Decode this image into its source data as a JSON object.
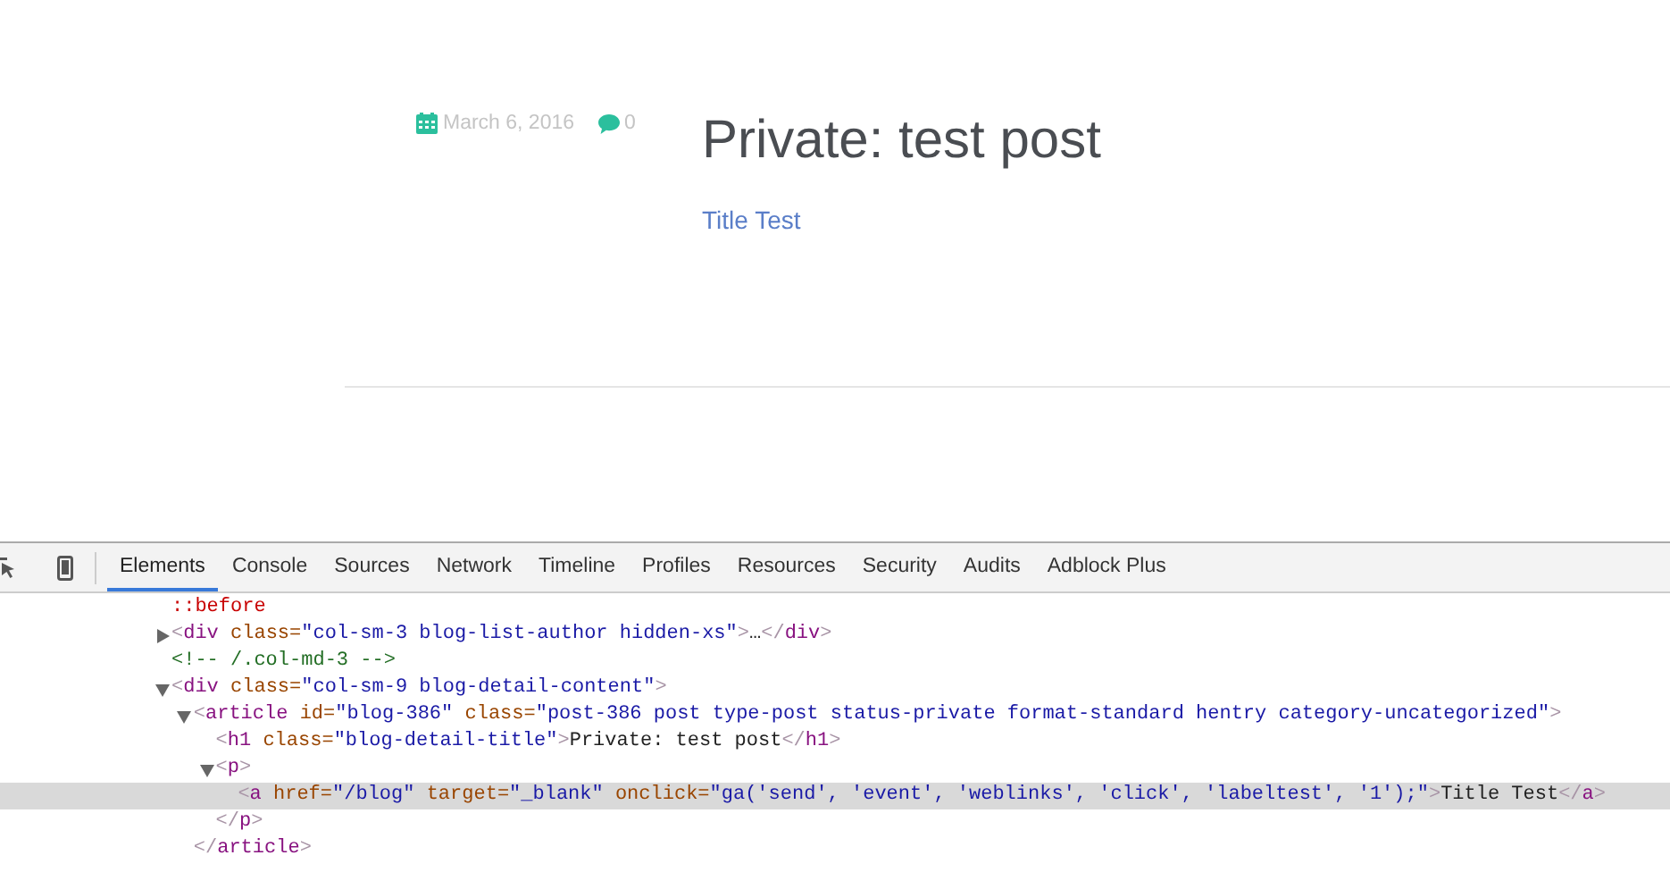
{
  "post": {
    "date": "March 6, 2016",
    "comments": "0",
    "title": "Private: test post",
    "link": "Title Test"
  },
  "devtools": {
    "tabs": [
      {
        "label": "Elements",
        "selected": true
      },
      {
        "label": "Console",
        "selected": false
      },
      {
        "label": "Sources",
        "selected": false
      },
      {
        "label": "Network",
        "selected": false
      },
      {
        "label": "Timeline",
        "selected": false
      },
      {
        "label": "Profiles",
        "selected": false
      },
      {
        "label": "Resources",
        "selected": false
      },
      {
        "label": "Security",
        "selected": false
      },
      {
        "label": "Audits",
        "selected": false
      },
      {
        "label": "Adblock Plus",
        "selected": false
      }
    ],
    "nodes": [
      {
        "selected": false,
        "tokens": [
          {
            "kind": "pseudo",
            "t": "::before"
          }
        ]
      },
      {
        "selected": false,
        "expanded": false,
        "tokens": [
          {
            "kind": "punct",
            "t": "<"
          },
          {
            "kind": "tag",
            "t": "div"
          },
          {
            "kind": "attr",
            "t": " class="
          },
          {
            "kind": "value",
            "t": "\"col-sm-3 blog-list-author hidden-xs\""
          },
          {
            "kind": "punct",
            "t": ">"
          },
          {
            "kind": "text",
            "t": "…"
          },
          {
            "kind": "punct",
            "t": "</"
          },
          {
            "kind": "tag",
            "t": "div"
          },
          {
            "kind": "punct",
            "t": ">"
          }
        ]
      },
      {
        "selected": false,
        "tokens": [
          {
            "kind": "comment",
            "t": "<!-- /.col-md-3 -->"
          }
        ]
      },
      {
        "selected": false,
        "expanded": true,
        "tokens": [
          {
            "kind": "punct",
            "t": "<"
          },
          {
            "kind": "tag",
            "t": "div"
          },
          {
            "kind": "attr",
            "t": " class="
          },
          {
            "kind": "value",
            "t": "\"col-sm-9 blog-detail-content\""
          },
          {
            "kind": "punct",
            "t": ">"
          }
        ],
        "children": [
          {
            "selected": false,
            "expanded": true,
            "tokens": [
              {
                "kind": "punct",
                "t": "<"
              },
              {
                "kind": "tag",
                "t": "article"
              },
              {
                "kind": "attr",
                "t": " id="
              },
              {
                "kind": "value",
                "t": "\"blog-386\""
              },
              {
                "kind": "attr",
                "t": " class="
              },
              {
                "kind": "value",
                "t": "\"post-386 post type-post status-private format-standard hentry category-uncategorized\""
              },
              {
                "kind": "punct",
                "t": ">"
              }
            ],
            "closing": [
              {
                "kind": "punct",
                "t": "</"
              },
              {
                "kind": "tag",
                "t": "article"
              },
              {
                "kind": "punct",
                "t": ">"
              }
            ],
            "children": [
              {
                "selected": false,
                "tokens": [
                  {
                    "kind": "punct",
                    "t": "<"
                  },
                  {
                    "kind": "tag",
                    "t": "h1"
                  },
                  {
                    "kind": "attr",
                    "t": " class="
                  },
                  {
                    "kind": "value",
                    "t": "\"blog-detail-title\""
                  },
                  {
                    "kind": "punct",
                    "t": ">"
                  },
                  {
                    "kind": "text",
                    "t": "Private: test post"
                  },
                  {
                    "kind": "punct",
                    "t": "</"
                  },
                  {
                    "kind": "tag",
                    "t": "h1"
                  },
                  {
                    "kind": "punct",
                    "t": ">"
                  }
                ]
              },
              {
                "selected": false,
                "expanded": true,
                "tokens": [
                  {
                    "kind": "punct",
                    "t": "<"
                  },
                  {
                    "kind": "tag",
                    "t": "p"
                  },
                  {
                    "kind": "punct",
                    "t": ">"
                  }
                ],
                "closing": [
                  {
                    "kind": "punct",
                    "t": "</"
                  },
                  {
                    "kind": "tag",
                    "t": "p"
                  },
                  {
                    "kind": "punct",
                    "t": ">"
                  }
                ],
                "children": [
                  {
                    "selected": true,
                    "tokens": [
                      {
                        "kind": "punct",
                        "t": "<"
                      },
                      {
                        "kind": "tag",
                        "t": "a"
                      },
                      {
                        "kind": "attr",
                        "t": " href="
                      },
                      {
                        "kind": "value",
                        "t": "\"/blog\""
                      },
                      {
                        "kind": "attr",
                        "t": " target="
                      },
                      {
                        "kind": "value",
                        "t": "\"_blank\""
                      },
                      {
                        "kind": "attr",
                        "t": " onclick="
                      },
                      {
                        "kind": "value",
                        "t": "\"ga('send', 'event', 'weblinks', 'click', 'labeltest', '1');\""
                      },
                      {
                        "kind": "punct",
                        "t": ">"
                      },
                      {
                        "kind": "text",
                        "t": "Title Test"
                      },
                      {
                        "kind": "punct",
                        "t": "</"
                      },
                      {
                        "kind": "tag",
                        "t": "a"
                      },
                      {
                        "kind": "punct",
                        "t": ">"
                      }
                    ]
                  }
                ]
              }
            ]
          }
        ]
      }
    ]
  }
}
